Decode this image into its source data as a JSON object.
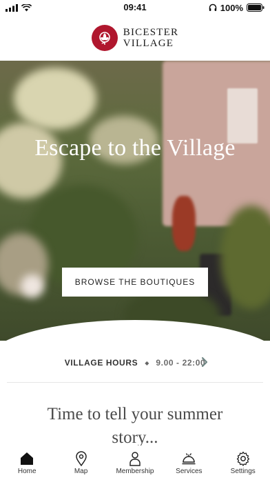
{
  "status_bar": {
    "time": "09:41",
    "battery": "100%"
  },
  "header": {
    "logo_line1": "BICESTER",
    "logo_line2": "VILLAGE"
  },
  "hero": {
    "title": "Escape to the Village",
    "cta_label": "BROWSE THE BOUTIQUES"
  },
  "hours": {
    "label": "VILLAGE HOURS",
    "separator": "◆",
    "value": "9.00 - 22:00"
  },
  "story": {
    "heading": "Time to tell your summer story..."
  },
  "tabs": [
    {
      "label": "Home",
      "icon": "home-icon",
      "active": true
    },
    {
      "label": "Map",
      "icon": "map-pin-icon"
    },
    {
      "label": "Membership",
      "icon": "person-icon"
    },
    {
      "label": "Services",
      "icon": "concierge-bell-icon"
    },
    {
      "label": "Settings",
      "icon": "gear-icon"
    }
  ],
  "colors": {
    "brand": "#b0172e",
    "cta_bg": "#ffffff"
  }
}
